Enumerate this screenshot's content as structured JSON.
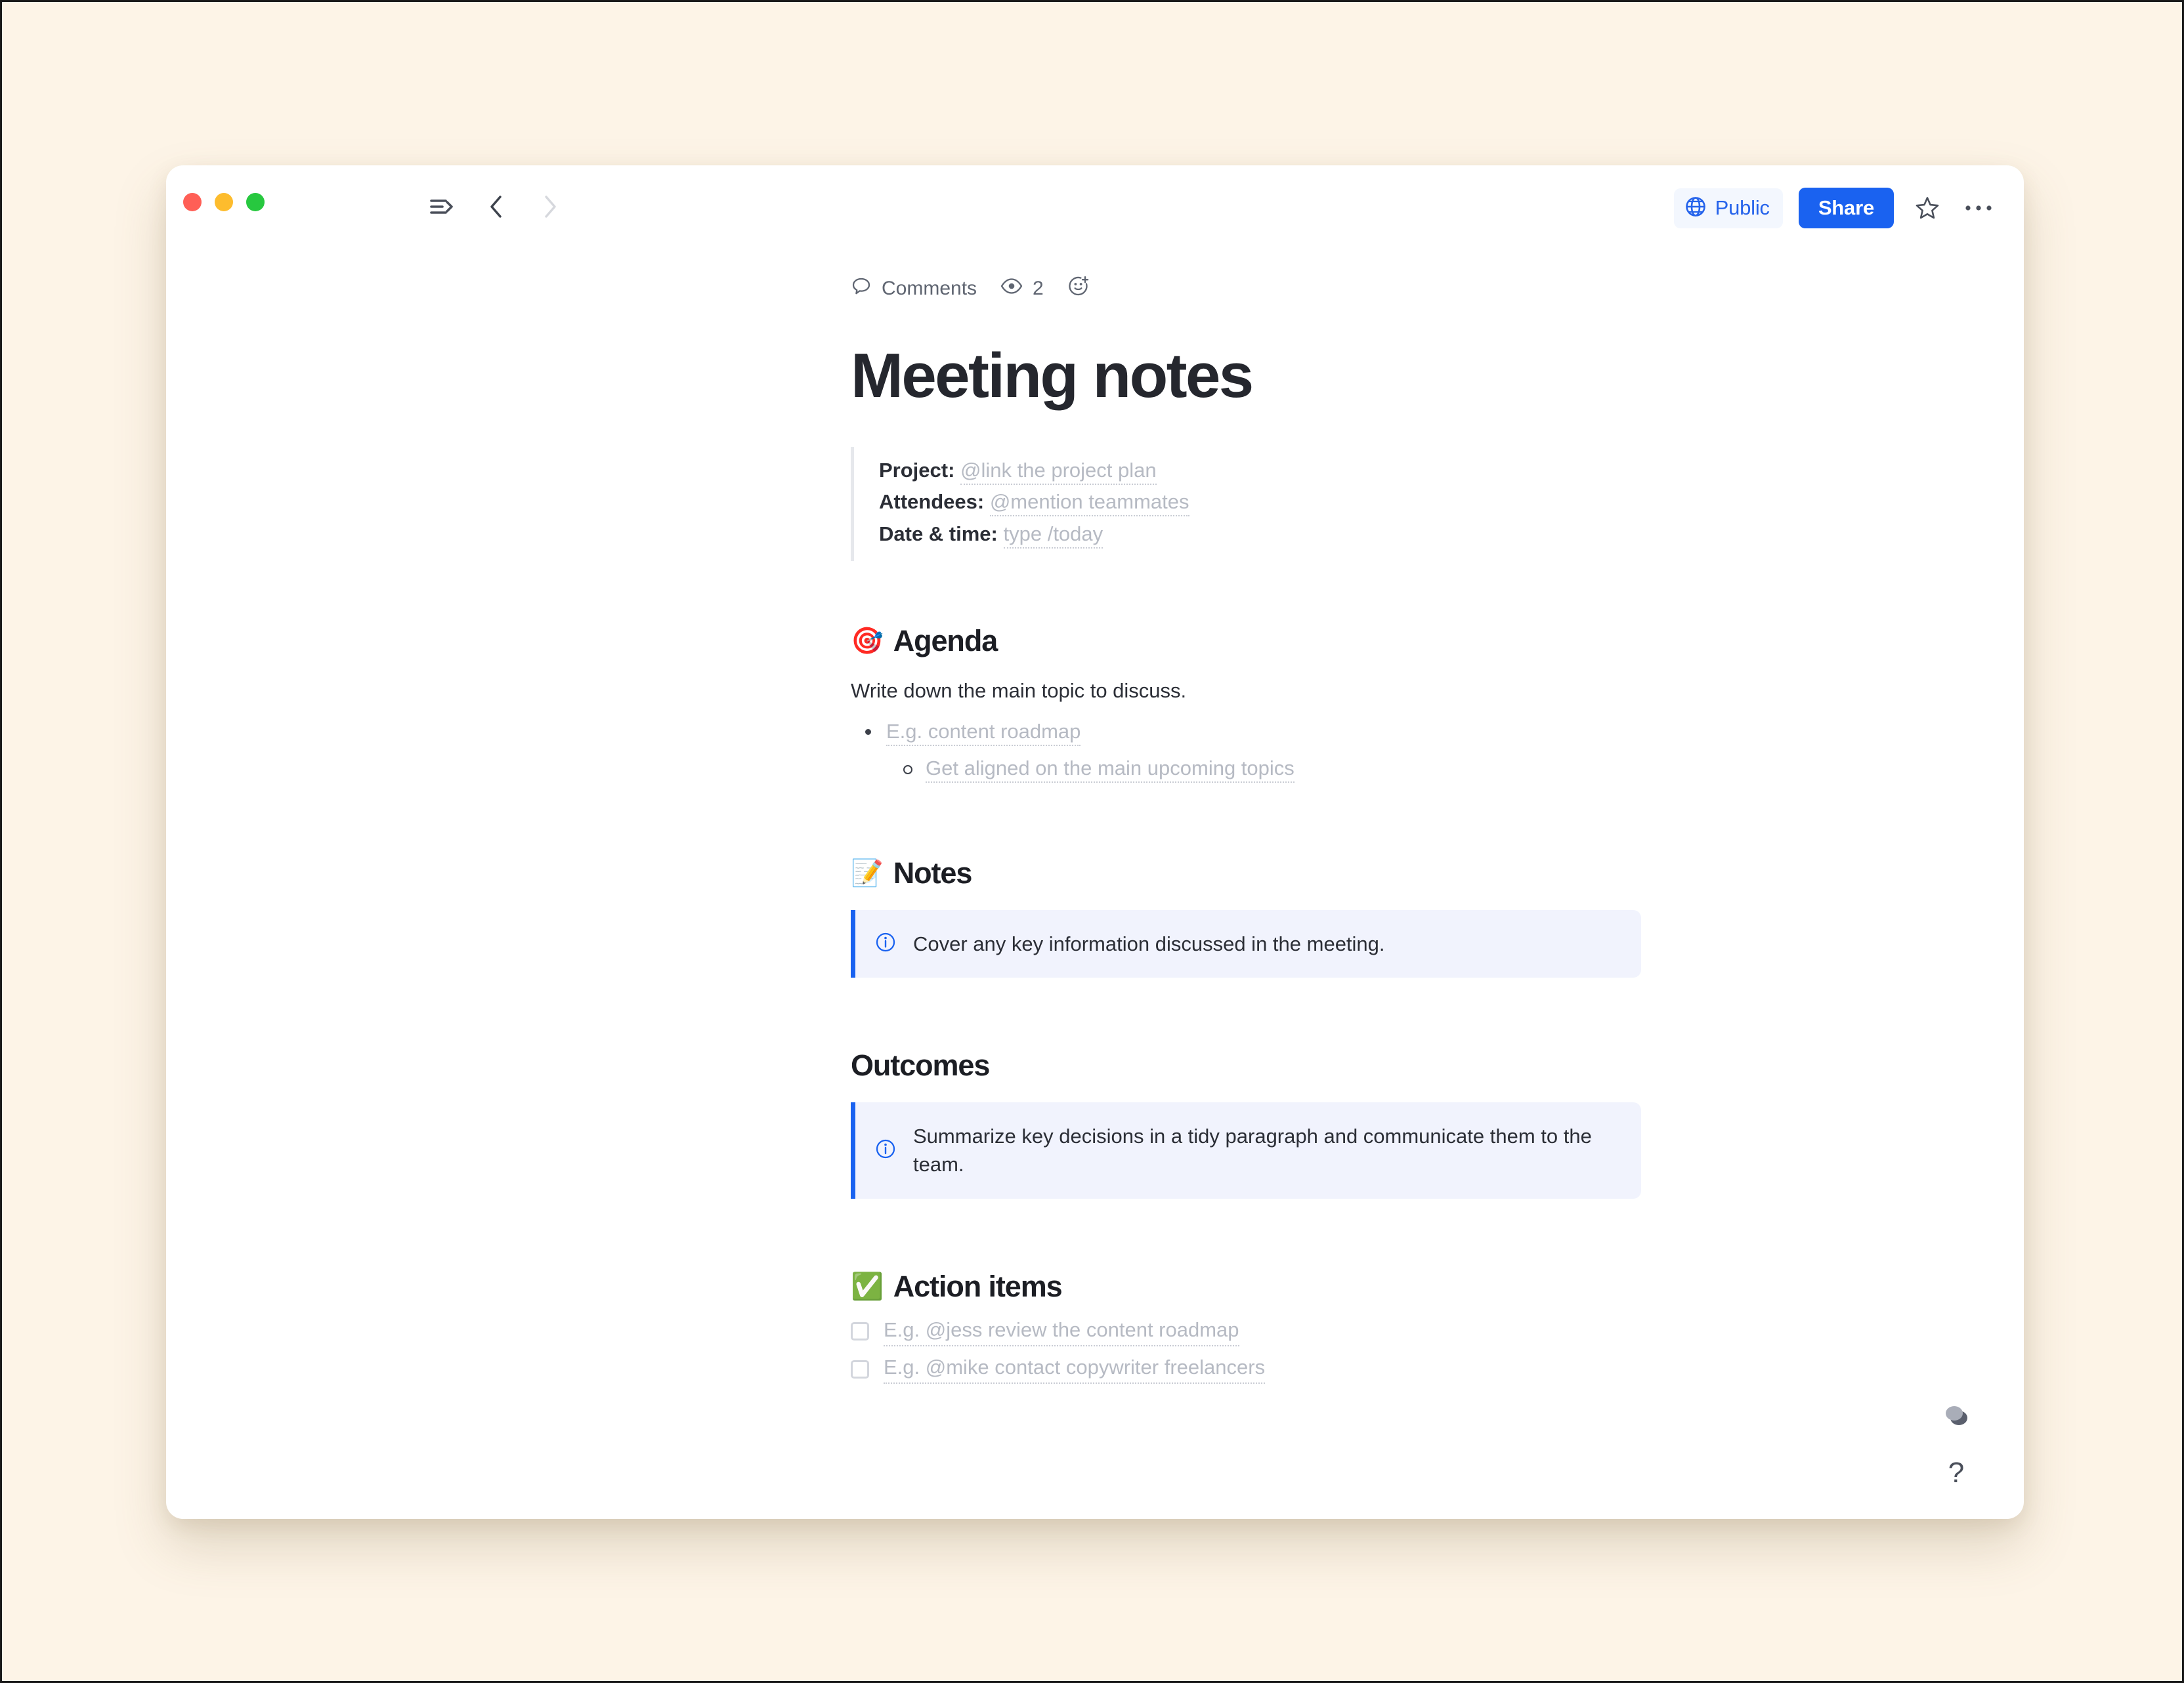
{
  "window": {
    "traffic_lights": [
      "close",
      "minimize",
      "maximize"
    ],
    "nav": {
      "sidebar_toggle_icon": "sidebar-expand-icon",
      "back_icon": "chevron-left-icon",
      "forward_icon": "chevron-right-icon"
    },
    "topright": {
      "visibility_label": "Public",
      "visibility_icon": "globe-icon",
      "share_label": "Share",
      "favorite_icon": "star-outline-icon",
      "more_icon": "ellipsis-icon"
    },
    "colors": {
      "accent_blue": "#1a62f0",
      "link_blue": "#2563eb",
      "callout_bg": "#f1f3fd",
      "page_bg": "#fdf4e7",
      "text_dark": "#25272e",
      "placeholder_gray": "#b6bac3"
    }
  },
  "meta": {
    "comments_label": "Comments",
    "comments_icon": "comment-bubble-icon",
    "views_icon": "eye-icon",
    "views_count": "2",
    "reaction_icon": "add-reaction-icon"
  },
  "doc": {
    "title": "Meeting notes",
    "info_block": [
      {
        "label": "Project:",
        "placeholder": "@link the project plan"
      },
      {
        "label": "Attendees:",
        "placeholder": "@mention teammates"
      },
      {
        "label": "Date & time:",
        "placeholder": "type /today"
      }
    ],
    "sections": {
      "agenda": {
        "emoji": "🎯",
        "heading": "Agenda",
        "body": "Write down the main topic to discuss.",
        "bullet": "E.g. content roadmap",
        "sub_bullet": "Get aligned on the main upcoming topics"
      },
      "notes": {
        "emoji": "📝",
        "heading": "Notes",
        "callout_icon": "info-circle-icon",
        "callout": "Cover any key information discussed in the meeting."
      },
      "outcomes": {
        "heading": "Outcomes",
        "callout_icon": "info-circle-icon",
        "callout": "Summarize key decisions in a tidy paragraph and communicate them to the team."
      },
      "action_items": {
        "emoji": "✅",
        "heading": "Action items",
        "items": [
          "E.g. @jess review the content roadmap",
          "E.g. @mike contact copywriter freelancers"
        ]
      }
    }
  },
  "corner": {
    "layers_icon": "layers-stack-icon",
    "help_label": "?"
  }
}
